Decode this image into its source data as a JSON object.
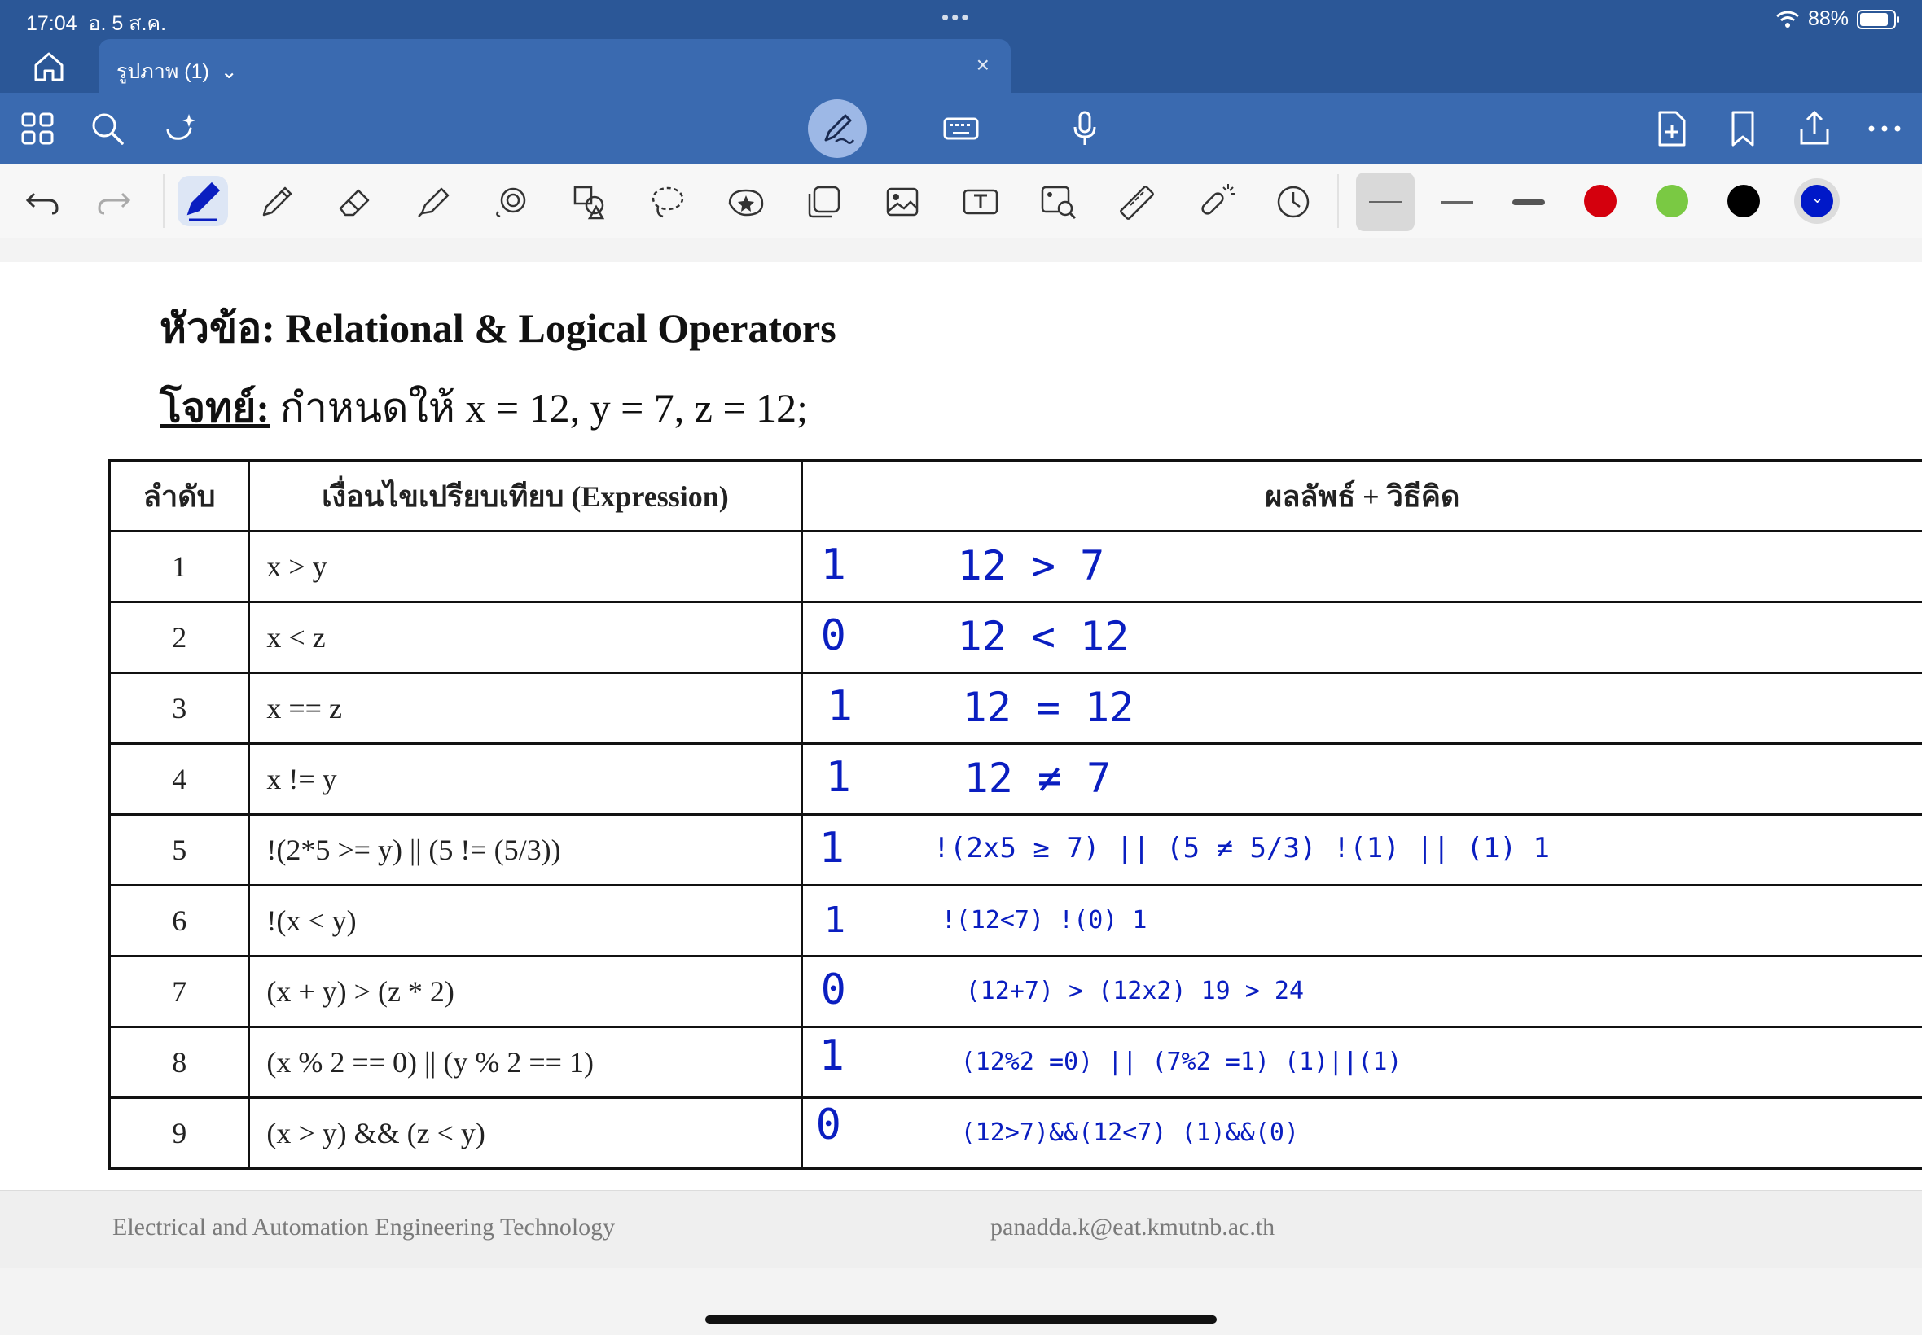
{
  "status": {
    "time": "17:04",
    "date": "อ. 5 ส.ค.",
    "battery": "88%"
  },
  "tabs": {
    "doc_title": "รูปภาพ (1)",
    "close": "×"
  },
  "ribbon": {
    "left_icons": [
      "grid-icon",
      "search-icon",
      "sparkle-lasso-icon"
    ],
    "center_icons": [
      "pen-mode-icon",
      "keyboard-icon",
      "microphone-icon"
    ],
    "right_icons": [
      "add-page-icon",
      "bookmark-icon",
      "share-icon",
      "more-icon"
    ]
  },
  "toolbar": {
    "tools": [
      "undo-icon",
      "redo-icon",
      "pen-icon",
      "pencil-icon",
      "eraser-icon",
      "highlighter-icon",
      "spiral-icon",
      "shapes-icon",
      "lasso-icon",
      "sticker-icon",
      "sticky-note-icon",
      "image-icon",
      "text-box-icon",
      "image-search-icon",
      "ruler-icon",
      "laser-pointer-icon",
      "clock-icon"
    ],
    "colors": {
      "red": "#d4000d",
      "green": "#7ac943",
      "black": "#000000",
      "blue": "#0018c8"
    }
  },
  "document": {
    "heading": "หัวข้อ: Relational & Logical Operators",
    "problem_label": "โจทย์:",
    "problem_text": " กำหนดให้ x = 12, y = 7, z = 12;",
    "table": {
      "headers": [
        "ลำดับ",
        "เงื่อนไขเปรียบเทียบ (Expression)",
        "ผลลัพธ์ + วิธีคิด"
      ],
      "rows": [
        {
          "no": "1",
          "expr": "x > y",
          "answer": "1",
          "work": "12 > 7"
        },
        {
          "no": "2",
          "expr": "x < z",
          "answer": "0",
          "work": "12 < 12"
        },
        {
          "no": "3",
          "expr": "x == z",
          "answer": "1",
          "work": "12 = 12"
        },
        {
          "no": "4",
          "expr": "x != y",
          "answer": "1",
          "work": "12 ≠ 7"
        },
        {
          "no": "5",
          "expr": "!(2*5 >= y) || (5 != (5/3))",
          "answer": "1",
          "work": "!(2x5 ≥ 7) || (5 ≠ 5/3)   !(1) || (1)     1"
        },
        {
          "no": "6",
          "expr": "!(x < y)",
          "answer": "1",
          "work": "!(12<7)   !(0)   1"
        },
        {
          "no": "7",
          "expr": "(x + y) > (z * 2)",
          "answer": "0",
          "work": "(12+7) > (12x2)    19 > 24"
        },
        {
          "no": "8",
          "expr": "(x % 2 == 0) || (y % 2 == 1)",
          "answer": "1",
          "work": "(12%2 =0) || (7%2 =1)    (1)||(1)"
        },
        {
          "no": "9",
          "expr": "(x > y) && (z < y)",
          "answer": "0",
          "work": "(12>7)&&(12<7)    (1)&&(0)"
        }
      ]
    }
  },
  "footer": {
    "left": "Electrical and Automation Engineering Technology",
    "right": "panadda.k@eat.kmutnb.ac.th"
  }
}
